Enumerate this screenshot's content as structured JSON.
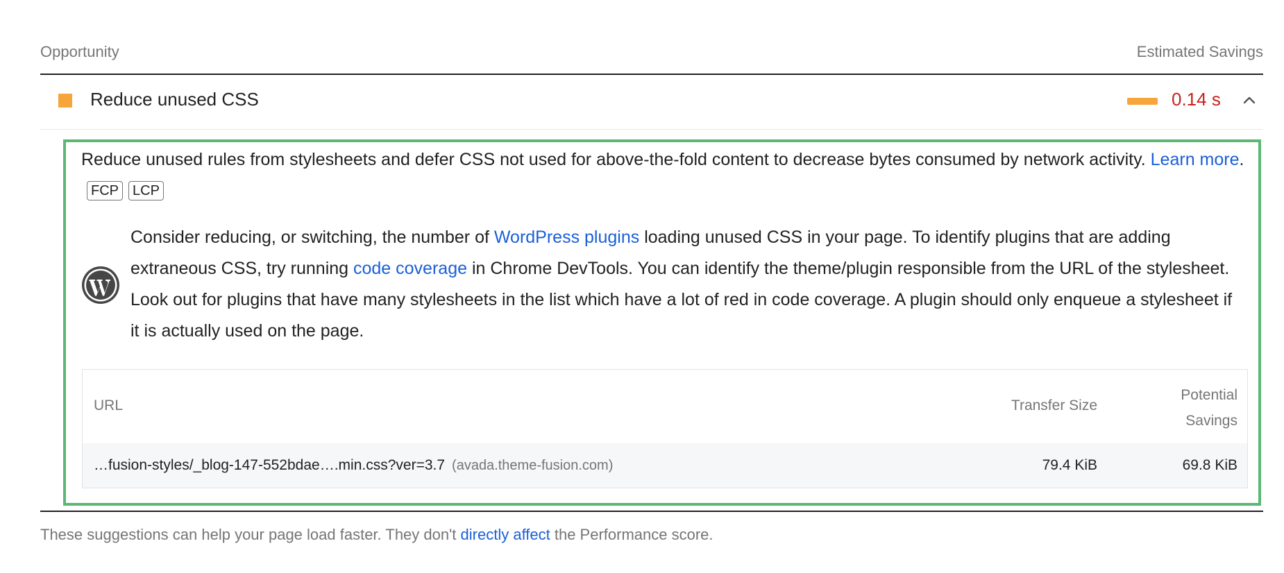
{
  "header": {
    "opportunity_label": "Opportunity",
    "savings_label": "Estimated Savings"
  },
  "audit": {
    "title": "Reduce unused CSS",
    "savings": "0.14 s",
    "status_color": "#f7a43a",
    "savings_color": "#c5221f",
    "expanded": true,
    "icon": "chevron-up-icon"
  },
  "description": {
    "text": "Reduce unused rules from stylesheets and defer CSS not used for above-the-fold content to decrease bytes consumed by network activity. ",
    "learn_more": "Learn more",
    "period": ".",
    "chips": [
      "FCP",
      "LCP"
    ]
  },
  "wordpress_tip": {
    "icon": "wordpress-icon",
    "part1": "Consider reducing, or switching, the number of ",
    "link1": "WordPress plugins",
    "part2": " loading unused CSS in your page. To identify plugins that are adding extraneous CSS, try running ",
    "link2": "code coverage",
    "part3": " in Chrome DevTools. You can identify the theme/plugin responsible from the URL of the stylesheet. Look out for plugins that have many stylesheets in the list which have a lot of red in code coverage. A plugin should only enqueue a stylesheet if it is actually used on the page."
  },
  "table": {
    "columns": {
      "url": "URL",
      "transfer_size": "Transfer Size",
      "potential_savings_line1": "Potential",
      "potential_savings_line2": "Savings"
    },
    "rows": [
      {
        "url": "…fusion-styles/_blog-147-552bdae….min.css?ver=3.7",
        "host": "(avada.theme-fusion.com)",
        "transfer_size": "79.4 KiB",
        "potential_savings": "69.8 KiB"
      }
    ]
  },
  "footer": {
    "part1": "These suggestions can help your page load faster. They don't ",
    "link": "directly affect",
    "part2": " the Performance score."
  },
  "highlight_color": "#5cb774"
}
